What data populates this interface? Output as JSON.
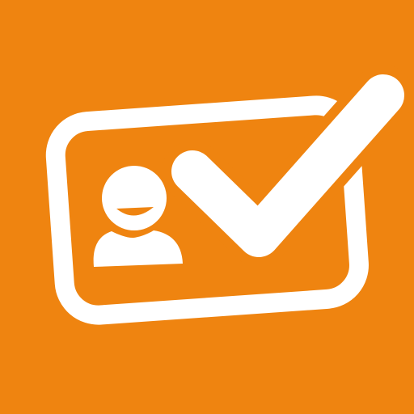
{
  "icon": {
    "name": "id-card-check-app-icon",
    "background_color": "#EF8410",
    "foreground_color": "#FFFFFF",
    "elements": [
      "id-card-icon",
      "person-avatar-icon",
      "checkmark-icon"
    ]
  }
}
